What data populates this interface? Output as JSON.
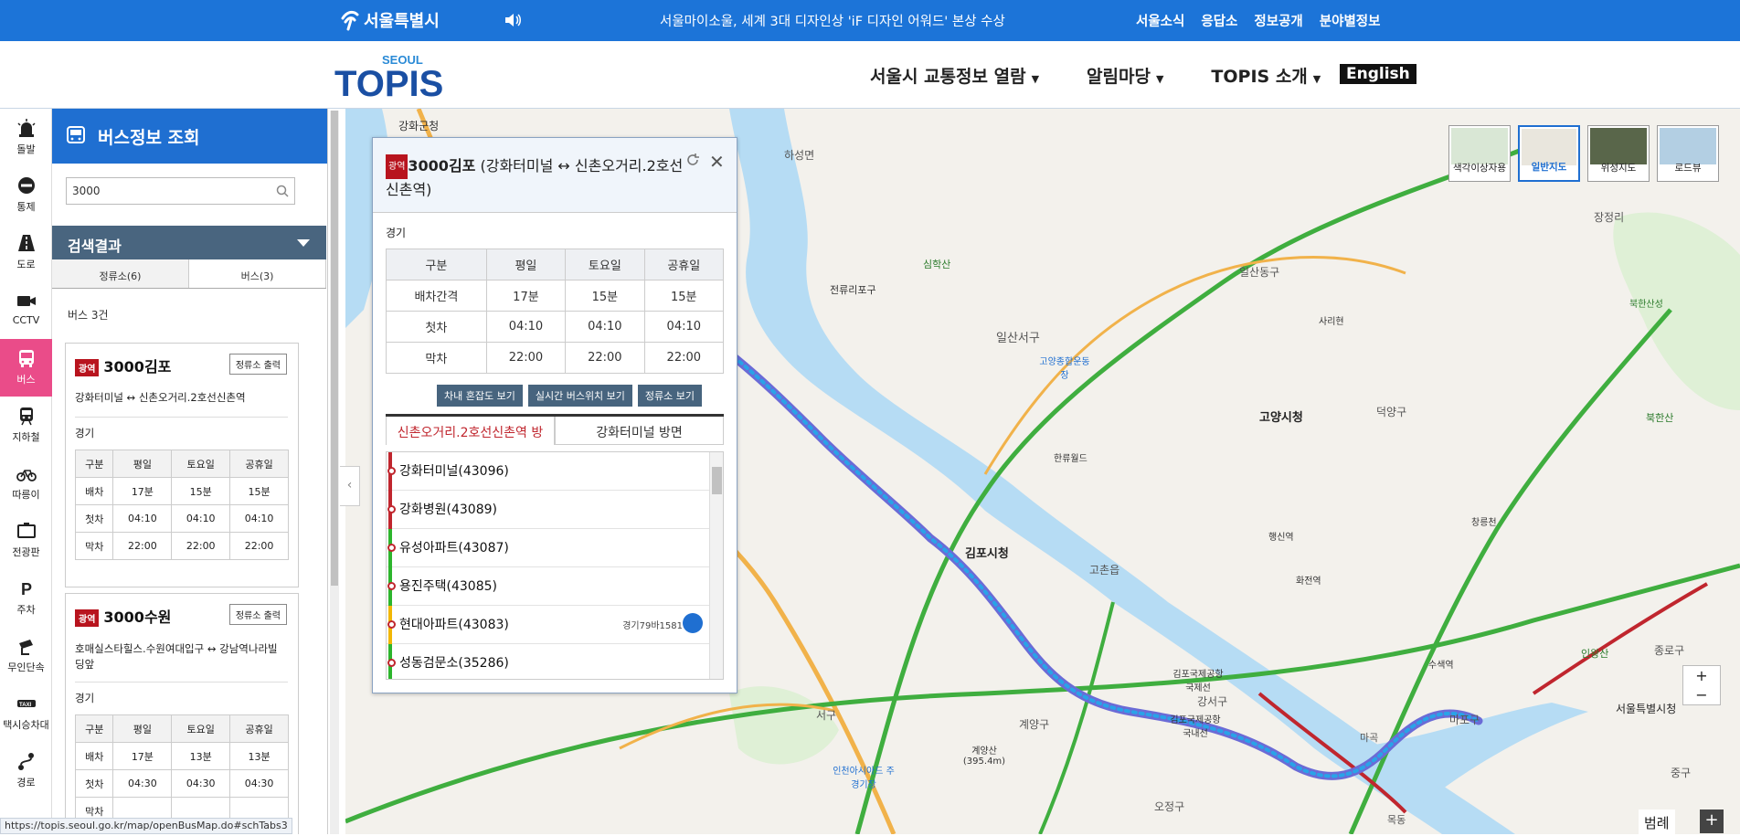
{
  "topbar": {
    "seoul_label": "서울특별시",
    "notice": "서울마이소울, 세계 3대 디자인상 'iF 디자인 어워드' 본상 수상",
    "links": [
      "서울소식",
      "응답소",
      "정보공개",
      "분야별정보"
    ]
  },
  "header": {
    "logo_small": "SEOUL",
    "logo": "TOPIS",
    "nav": [
      "서울시 교통정보 열람",
      "알림마당",
      "TOPIS 소개"
    ],
    "english": "English"
  },
  "iconbar": [
    "돌발",
    "통제",
    "도로",
    "CCTV",
    "버스",
    "지하철",
    "따릉이",
    "전광판",
    "주차",
    "무인단속",
    "택시승차대",
    "경로"
  ],
  "side": {
    "title": "버스정보 조회",
    "search_value": "3000",
    "results_label": "검색결과",
    "tab_stops": "정류소(6)",
    "tab_bus": "버스(3)",
    "count": "버스 3건",
    "print_label": "정류소 출력",
    "badge": "광역",
    "headers": [
      "구분",
      "평일",
      "토요일",
      "공휴일"
    ],
    "cards": [
      {
        "number": "3000김포",
        "route": "강화터미널 ↔ 신촌오거리.2호선신촌역",
        "area": "경기",
        "rows": [
          [
            "배차",
            "17분",
            "15분",
            "15분"
          ],
          [
            "첫차",
            "04:10",
            "04:10",
            "04:10"
          ],
          [
            "막차",
            "22:00",
            "22:00",
            "22:00"
          ]
        ]
      },
      {
        "number": "3000수원",
        "route": "호매실스타힐스.수원여대입구 ↔ 강남역나라빌딩앞",
        "area": "경기",
        "rows": [
          [
            "배차",
            "17분",
            "13분",
            "13분"
          ],
          [
            "첫차",
            "04:30",
            "04:30",
            "04:30"
          ],
          [
            "막차",
            "",
            "",
            ""
          ]
        ]
      }
    ]
  },
  "popup": {
    "badge": "광역",
    "number": "3000김포",
    "route": "(강화터미널 ↔ 신촌오거리.2호선신촌역)",
    "area": "경기",
    "headers": [
      "구분",
      "평일",
      "토요일",
      "공휴일"
    ],
    "rows": [
      [
        "배차간격",
        "17분",
        "15분",
        "15분"
      ],
      [
        "첫차",
        "04:10",
        "04:10",
        "04:10"
      ],
      [
        "막차",
        "22:00",
        "22:00",
        "22:00"
      ]
    ],
    "buttons": [
      "차내 혼잡도 보기",
      "실시간 버스위치 보기",
      "정류소 보기"
    ],
    "dir_tabs": [
      "신촌오거리.2호선신촌역 방",
      "강화터미널 방면"
    ],
    "stops": [
      {
        "name": "강화터미널(43096)",
        "color": "#c0262e"
      },
      {
        "name": "강화병원(43089)",
        "color": "#c0262e"
      },
      {
        "name": "유성아파트(43087)",
        "color": "#2db52d"
      },
      {
        "name": "용진주택(43085)",
        "color": "#2db52d"
      },
      {
        "name": "현대아파트(43083)",
        "color": "#f2b705",
        "plate": "경기79바1581"
      },
      {
        "name": "성동검문소(35286)",
        "color": "#2db52d"
      }
    ]
  },
  "map": {
    "types": [
      "색각이상자용",
      "일반지도",
      "위성지도",
      "로드뷰"
    ],
    "selected_type": "일반지도",
    "labels": [
      "강화군청",
      "하성면",
      "전류리포구",
      "심학산",
      "일산동구",
      "장정리",
      "일산서구",
      "고양종합운동장",
      "고양시청",
      "덕양구",
      "북한산",
      "김포시청",
      "한류월드",
      "고촌읍",
      "행신역",
      "화전역",
      "강서구",
      "서구",
      "계양구",
      "계양산 (395.4m)",
      "인천아시아드 주경기장",
      "김포국제공항 국제선",
      "김포국제공항 국내선",
      "마포구",
      "서울특별시청",
      "종로구",
      "인왕산",
      "수색역",
      "오정구",
      "중구",
      "마곡",
      "목동",
      "북한산성",
      "사리현",
      "창릉천"
    ],
    "zoom_in": "+",
    "zoom_out": "−",
    "legend": "범례",
    "legend_plus": "+"
  },
  "status_url": "https://topis.seoul.go.kr/map/openBusMap.do#schTabs3"
}
